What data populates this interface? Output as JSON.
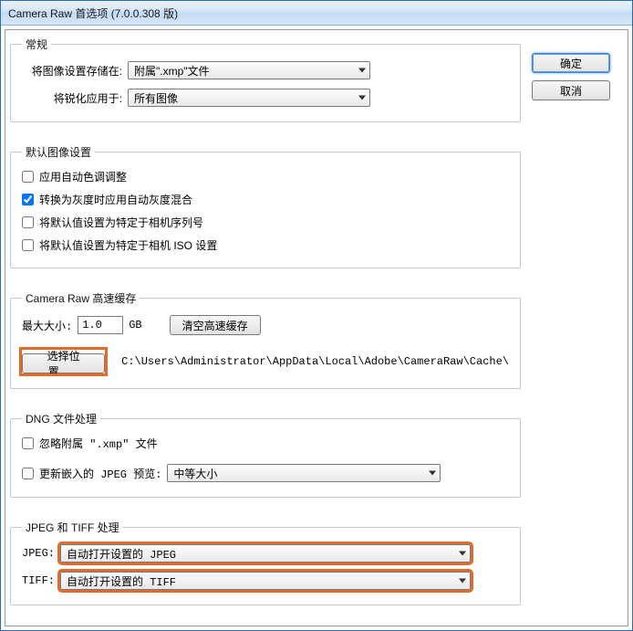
{
  "titlebar": "Camera Raw 首选项  (7.0.0.308 版)",
  "buttons": {
    "ok": "确定",
    "cancel": "取消"
  },
  "general": {
    "legend": "常规",
    "save_label": "将图像设置存储在:",
    "save_value": "附属\".xmp\"文件",
    "sharpen_label": "将锐化应用于:",
    "sharpen_value": "所有图像"
  },
  "defaults": {
    "legend": "默认图像设置",
    "auto_tone": "应用自动色调调整",
    "auto_gray": "转换为灰度时应用自动灰度混合",
    "specific_serial": "将默认值设置为特定于相机序列号",
    "specific_iso": "将默认值设置为特定于相机 ISO 设置"
  },
  "cache": {
    "legend": "Camera Raw 高速缓存",
    "max_label": "最大大小:",
    "max_value": "1.0",
    "max_unit": "GB",
    "purge_btn": "清空高速缓存",
    "select_btn": "选择位置...",
    "path": "C:\\Users\\Administrator\\AppData\\Local\\Adobe\\CameraRaw\\Cache\\"
  },
  "dng": {
    "legend": "DNG 文件处理",
    "ignore_xmp": "忽略附属 \".xmp\" 文件",
    "update_jpeg_label": "更新嵌入的 JPEG 预览:",
    "update_jpeg_value": "中等大小"
  },
  "jpegtiff": {
    "legend": "JPEG 和 TIFF 处理",
    "jpeg_label": "JPEG:",
    "jpeg_value": "自动打开设置的 JPEG",
    "tiff_label": "TIFF:",
    "tiff_value": "自动打开设置的 TIFF"
  }
}
